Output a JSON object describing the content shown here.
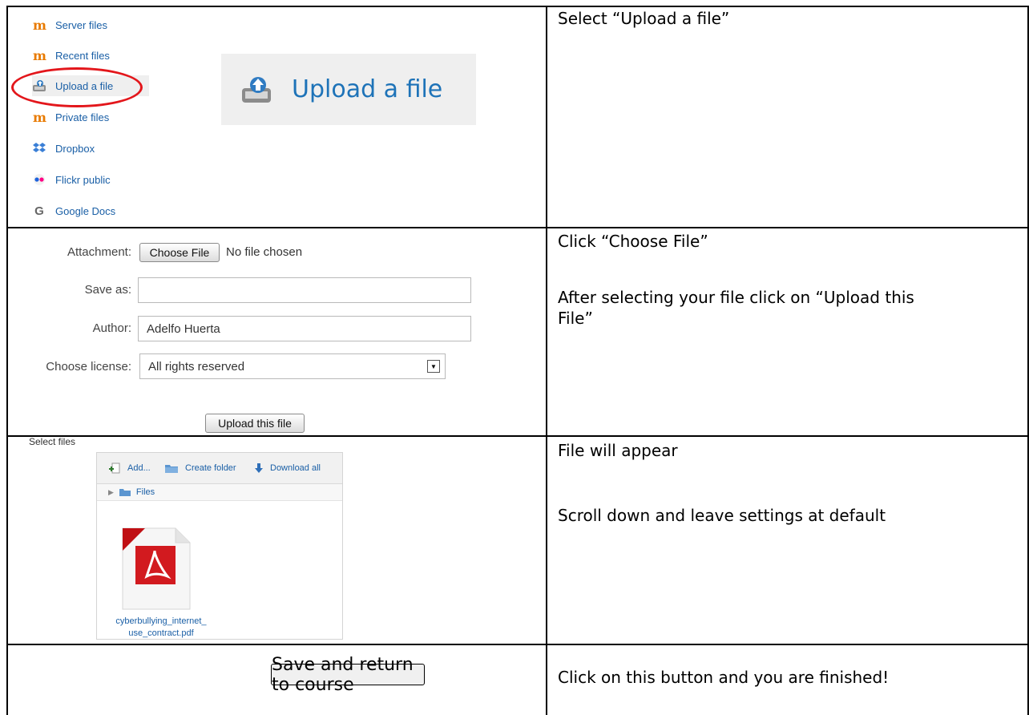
{
  "repository": {
    "items": [
      {
        "label": "Server files",
        "icon": "moodle-icon"
      },
      {
        "label": "Recent files",
        "icon": "moodle-icon"
      },
      {
        "label": "Upload a file",
        "icon": "upload-icon"
      },
      {
        "label": "Private files",
        "icon": "moodle-icon"
      },
      {
        "label": "Dropbox",
        "icon": "dropbox-icon"
      },
      {
        "label": "Flickr public",
        "icon": "flickr-icon"
      },
      {
        "label": "Google Docs",
        "icon": "google-icon"
      }
    ],
    "moodle_glyph": "m",
    "google_glyph": "G",
    "upload_banner": "Upload a file",
    "highlight_color": "#e3161b"
  },
  "upload_form": {
    "attachment_label": "Attachment:",
    "choose_file_button": "Choose File",
    "no_file_text": "No file chosen",
    "save_as_label": "Save as:",
    "save_as_value": "",
    "author_label": "Author:",
    "author_value": "Adelfo Huerta",
    "license_label": "Choose license:",
    "license_value": "All rights reserved",
    "upload_button": "Upload this file"
  },
  "file_manager": {
    "section_label": "Select files",
    "add_label": "Add...",
    "create_folder_label": "Create folder",
    "download_all_label": "Download all",
    "path_label": "Files",
    "filename_line1": "cyberbullying_internet_",
    "filename_line2": "use_contract.pdf"
  },
  "finish": {
    "button_label": "Save and return to course"
  },
  "instructions": {
    "step1": "Select “Upload a file”",
    "step2_line1": "Click “Choose File”",
    "step2_line2": "After selecting your file click on “Upload this",
    "step2_line3": "File”",
    "step3_line1": "File will appear",
    "step3_line2": "Scroll down and leave settings at default",
    "step4": "Click on this button and you are finished!"
  }
}
